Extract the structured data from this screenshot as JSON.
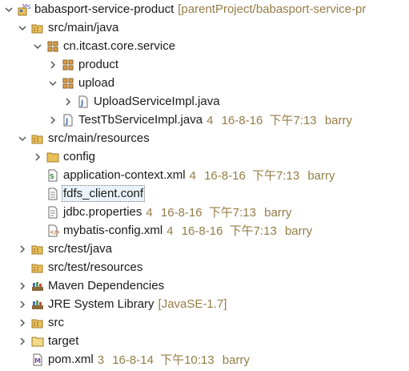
{
  "tree": {
    "project": {
      "name": "babasport-service-product",
      "decoration": "[parentProject/babasport-service-pr"
    },
    "src_main_java": {
      "name": "src/main/java"
    },
    "package_service": {
      "name": "cn.itcast.core.service"
    },
    "package_product": {
      "name": "product"
    },
    "package_upload": {
      "name": "upload"
    },
    "upload_impl": {
      "name": "UploadServiceImpl.java"
    },
    "test_impl": {
      "name": "TestTbServiceImpl.java",
      "revision": "4",
      "date": "16-8-16",
      "time": "下午7:13",
      "author": "barry"
    },
    "src_main_resources": {
      "name": "src/main/resources"
    },
    "folder_config": {
      "name": "config"
    },
    "app_context": {
      "name": "application-context.xml",
      "revision": "4",
      "date": "16-8-16",
      "time": "下午7:13",
      "author": "barry"
    },
    "fdfs_conf": {
      "name": "fdfs_client.conf"
    },
    "jdbc_props": {
      "name": "jdbc.properties",
      "revision": "4",
      "date": "16-8-16",
      "time": "下午7:13",
      "author": "barry"
    },
    "mybatis_config": {
      "name": "mybatis-config.xml",
      "revision": "4",
      "date": "16-8-16",
      "time": "下午7:13",
      "author": "barry"
    },
    "src_test_java": {
      "name": "src/test/java"
    },
    "src_test_resources": {
      "name": "src/test/resources"
    },
    "maven_deps": {
      "name": "Maven Dependencies"
    },
    "jre_lib": {
      "name": "JRE System Library",
      "decoration": "[JavaSE-1.7]"
    },
    "folder_src": {
      "name": "src"
    },
    "folder_target": {
      "name": "target"
    },
    "pom": {
      "name": "pom.xml",
      "revision": "3",
      "date": "16-8-14",
      "time": "下午10:13",
      "author": "barry"
    }
  },
  "colors": {
    "decoration": "#957d47",
    "folder": "#e8c15a",
    "package": "#b5833d",
    "java_blue": "#4a6fb5",
    "jar": "#8a6a3a"
  },
  "icons": {
    "expanded": "chevron-down-icon",
    "collapsed": "chevron-right-icon"
  }
}
